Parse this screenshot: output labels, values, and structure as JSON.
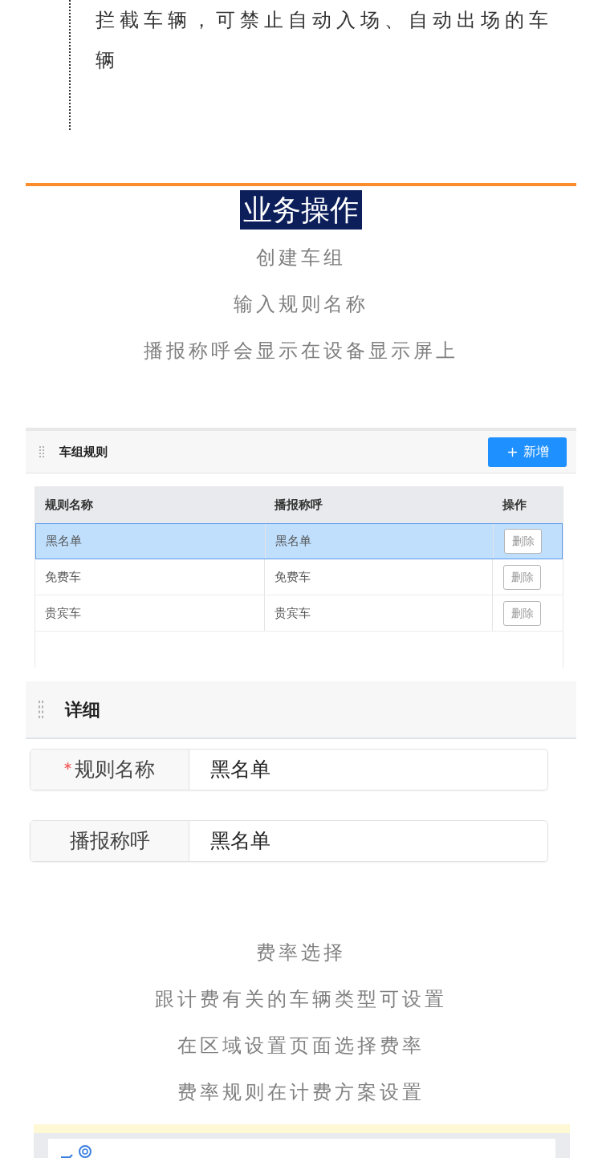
{
  "note_block": {
    "text": "拦截车辆，可禁止自动入场、自动出场的车辆"
  },
  "section": {
    "title": "业务操作"
  },
  "intro_lines": [
    "创建车组",
    "输入规则名称",
    "播报称呼会显示在设备显示屏上"
  ],
  "rule_panel": {
    "title": "车组规则",
    "add_button": "新增",
    "table": {
      "columns": [
        "规则名称",
        "播报称呼",
        "操作"
      ],
      "rows": [
        {
          "name": "黑名单",
          "announcement": "黑名单",
          "action": "删除",
          "selected": true
        },
        {
          "name": "免费车",
          "announcement": "免费车",
          "action": "删除",
          "selected": false
        },
        {
          "name": "贵宾车",
          "announcement": "贵宾车",
          "action": "删除",
          "selected": false
        }
      ]
    }
  },
  "detail_panel": {
    "title": "详细",
    "fields": [
      {
        "label": "规则名称",
        "required": true,
        "value": "黑名单"
      },
      {
        "label": "播报称呼",
        "required": false,
        "value": "黑名单"
      }
    ]
  },
  "rate_lines": [
    "费率选择",
    "跟计费有关的车辆类型可设置",
    "在区域设置页面选择费率",
    "费率规则在计费方案设置"
  ]
}
